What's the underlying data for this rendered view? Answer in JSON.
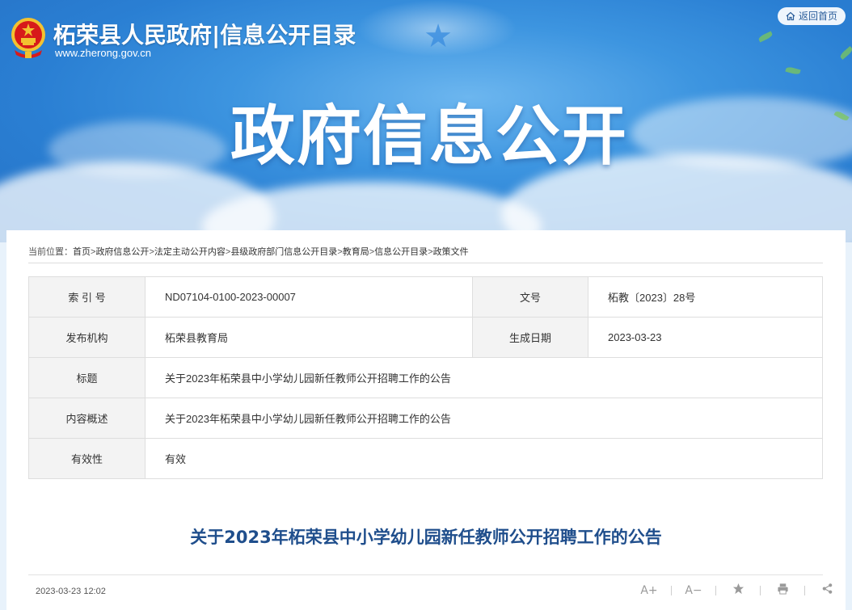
{
  "header": {
    "site_title": "柘荣县人民政府|信息公开目录",
    "site_url": "www.zherong.gov.cn",
    "return_home": "返回首页",
    "hero_title": "政府信息公开"
  },
  "breadcrumb": {
    "prefix": "当前位置：",
    "items": [
      "首页",
      "政府信息公开",
      "法定主动公开内容",
      "县级政府部门信息公开目录",
      "教育局",
      "信息公开目录",
      "政策文件"
    ],
    "separator": ">"
  },
  "meta": {
    "index_label": "索 引 号",
    "index_value": "ND07104-0100-2023-00007",
    "docno_label": "文号",
    "docno_value": "柘教〔2023〕28号",
    "org_label": "发布机构",
    "org_value": "柘荣县教育局",
    "date_label": "生成日期",
    "date_value": "2023-03-23",
    "title_label": "标题",
    "title_value": "关于2023年柘荣县中小学幼儿园新任教师公开招聘工作的公告",
    "summary_label": "内容概述",
    "summary_value": "关于2023年柘荣县中小学幼儿园新任教师公开招聘工作的公告",
    "validity_label": "有效性",
    "validity_value": "有效"
  },
  "article": {
    "title": "关于2023年柘荣县中小学幼儿园新任教师公开招聘工作的公告",
    "datetime": "2023-03-23 12:02"
  },
  "tools": {
    "font_increase": "A+",
    "font_decrease": "A−",
    "icons": [
      "font-increase-icon",
      "font-decrease-icon",
      "star-icon",
      "print-icon",
      "share-icon"
    ]
  },
  "colors": {
    "banner_blue": "#2a7fd3",
    "title_blue": "#1f4e8c",
    "emblem_red": "#d71a1a",
    "emblem_gold": "#f2c230"
  }
}
